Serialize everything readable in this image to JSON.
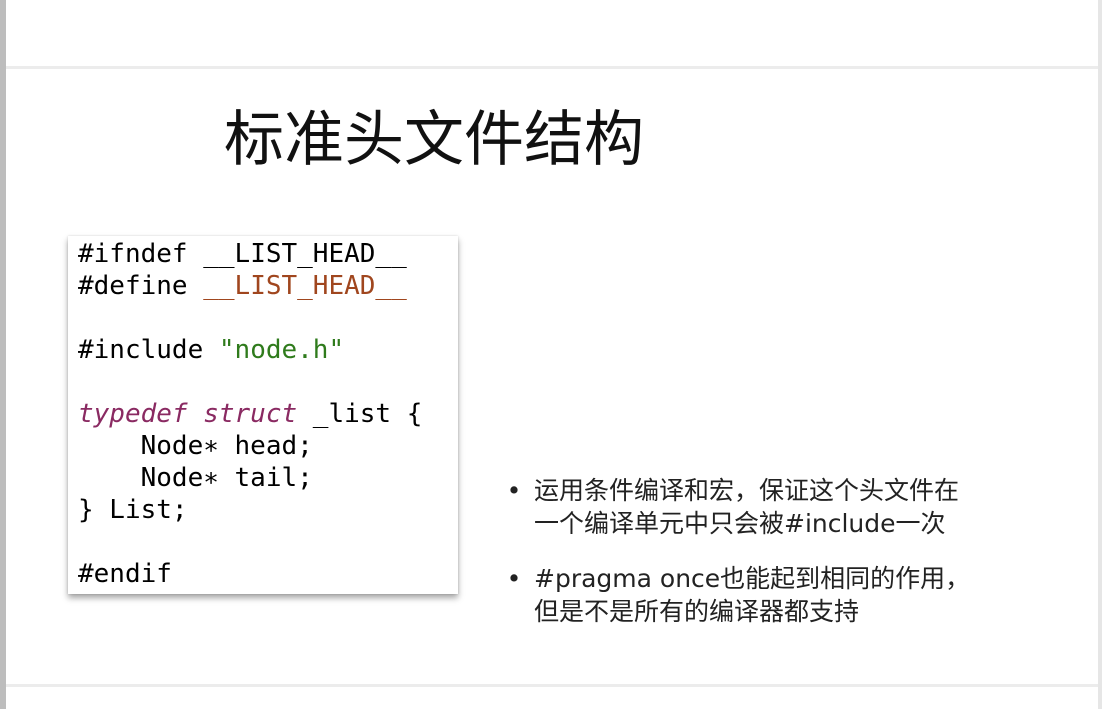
{
  "slide": {
    "title": "标准头文件结构"
  },
  "code": {
    "l1_a": "#ifndef ",
    "l1_b": "__LIST_HEAD__",
    "l2_a": "#define ",
    "l2_b": "__LIST_HEAD__",
    "l3_a": "#include ",
    "l3_b": "\"node.h\"",
    "l4_a": "typedef struct",
    "l4_b": " _list {",
    "l5": "    Node∗ head;",
    "l6": "    Node∗ tail;",
    "l7": "} List;",
    "l8": "#endif"
  },
  "bullets": [
    {
      "dot": "•",
      "line1": "运用条件编译和宏，保证这个头文件在",
      "line2": "一个编译单元中只会被#include一次"
    },
    {
      "dot": "•",
      "line1": "#pragma once也能起到相同的作用，",
      "line2": "但是不是所有的编译器都支持"
    }
  ],
  "colors": {
    "macro_name": "#a0461e",
    "string": "#2f7b1c",
    "type_keyword": "#8a2a62"
  }
}
